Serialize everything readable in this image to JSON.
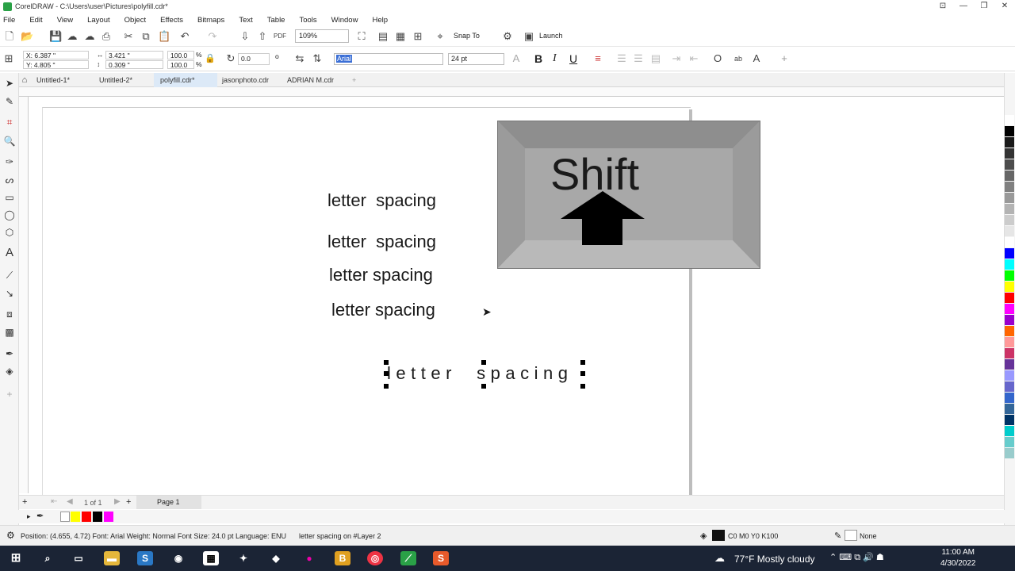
{
  "window": {
    "title": "CorelDRAW - C:\\Users\\user\\Pictures\\polyfill.cdr*",
    "controls": [
      "⊡",
      "—",
      "❐",
      "✕"
    ]
  },
  "menu": [
    "File",
    "Edit",
    "View",
    "Layout",
    "Object",
    "Effects",
    "Bitmaps",
    "Text",
    "Table",
    "Tools",
    "Window",
    "Help"
  ],
  "toolbar": {
    "zoom": "109%",
    "snap_to": "Snap To",
    "launch": "Launch"
  },
  "property_bar": {
    "x": "X: 6.387 \"",
    "y": "Y: 4.805 \"",
    "width": "3.421 \"",
    "height": "0.309 \"",
    "scale_w": "100.0",
    "scale_h": "100.0",
    "percent": "%",
    "rotation": "0.0",
    "font_name": "Arial",
    "font_size": "24 pt",
    "bold": "B",
    "italic": "I",
    "underline": "U"
  },
  "tabs": [
    "Untitled-1*",
    "Untitled-2*",
    "polyfill.cdr*",
    "jasonphoto.cdr",
    "ADRIAN M.cdr"
  ],
  "active_tab": "polyfill.cdr*",
  "canvas": {
    "texts": [
      "letter  spacing",
      "letter  spacing",
      "letter spacing",
      "letter spacing"
    ],
    "wide_text": "letter  spacing",
    "shift_key_label": "Shift"
  },
  "page_nav": {
    "page_count": "1 of 1",
    "page_tab": "Page 1"
  },
  "status": {
    "info": "Position: (4.655, 4.72)  Font: Arial  Weight: Normal  Font Size: 24.0 pt  Language: ENU",
    "layer": "letter  spacing on #Layer 2",
    "fill": "C0 M0 Y0 K100",
    "outline": "None"
  },
  "taskbar": {
    "weather": "77°F  Mostly cloudy",
    "time": "11:00 AM",
    "date": "4/30/2022"
  },
  "palette_colors": [
    "#ffffff",
    "#000000",
    "#1a1a1a",
    "#333333",
    "#4d4d4d",
    "#666666",
    "#808080",
    "#999999",
    "#b3b3b3",
    "#cccccc",
    "#e6e6e6",
    "#ffffff",
    "#0000ff",
    "#00ffff",
    "#00ff00",
    "#ffff00",
    "#ff0000",
    "#ff00ff",
    "#9900cc",
    "#ff6600",
    "#ff9999",
    "#cc3366",
    "#663399",
    "#9999ff",
    "#6666cc",
    "#3366cc",
    "#336699",
    "#003366",
    "#00cccc",
    "#66cccc",
    "#99cccc"
  ]
}
